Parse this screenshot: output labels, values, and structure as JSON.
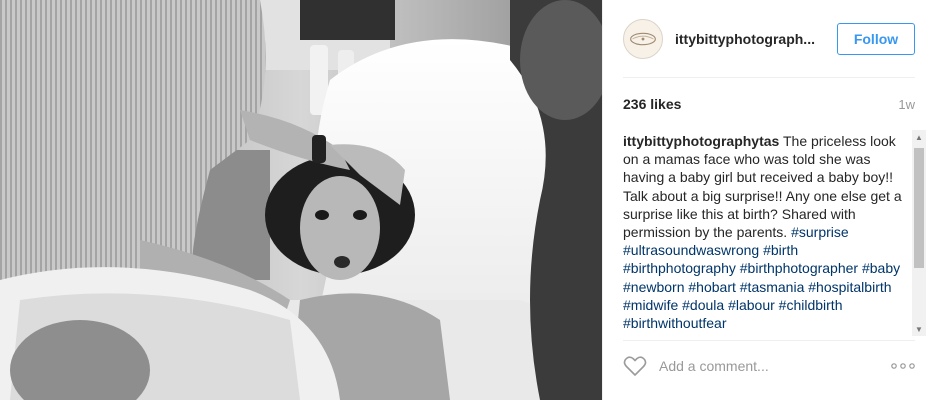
{
  "post": {
    "photo_icon": "photo-newborn-birth-bw",
    "account": {
      "avatar_icon": "brand-logo-avatar",
      "username": "ittybittyphotograph...",
      "follow_label": "Follow"
    },
    "likes": "236 likes",
    "age": "1w",
    "caption": {
      "username": "ittybittyphotographytas",
      "text": "The priceless look on a mamas face who was told she was having a baby girl but received a baby boy!! Talk about a big surprise!! Any one else get a surprise like this at birth? Shared with permission by the parents.",
      "hashtags": [
        "#surprise",
        "#ultrasoundwaswrong",
        "#birth",
        "#birthphotography",
        "#birthphotographer",
        "#baby",
        "#newborn",
        "#hobart",
        "#tasmania",
        "#hospitalbirth",
        "#midwife",
        "#doula",
        "#labour",
        "#childbirth",
        "#birthwithoutfear"
      ]
    },
    "comment": {
      "placeholder": "Add a comment...",
      "like_icon": "heart-outline-icon",
      "more_icon": "more-options-icon"
    },
    "colors": {
      "follow_blue": "#3897f0",
      "hashtag_blue": "#003569",
      "text": "#262626",
      "muted": "#999999",
      "divider": "#efefef"
    }
  }
}
